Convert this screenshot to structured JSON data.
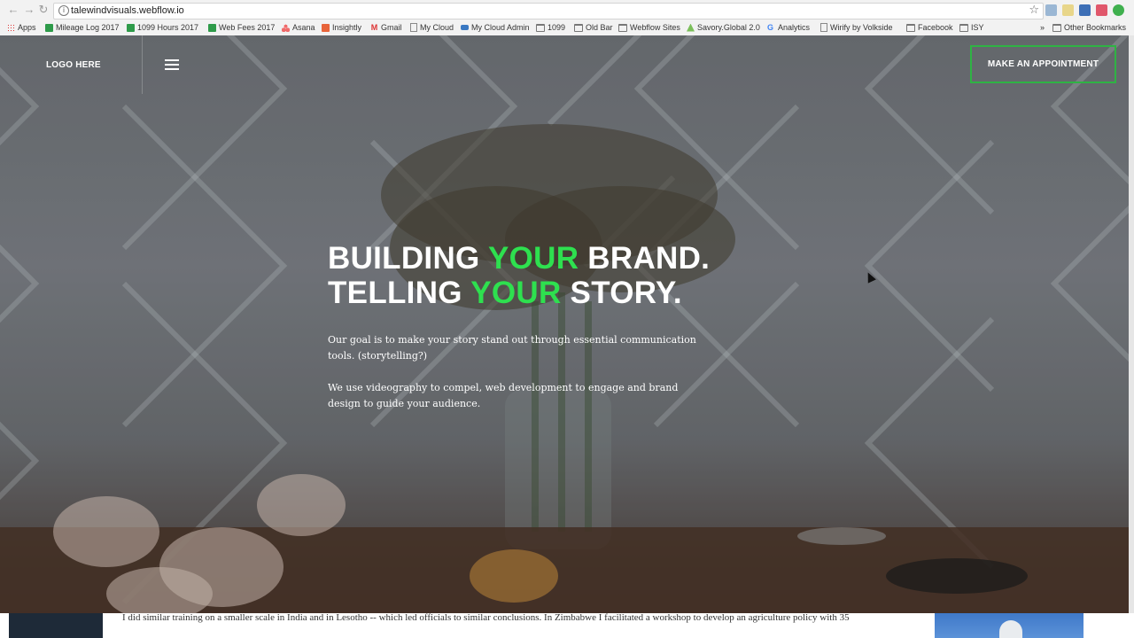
{
  "browser": {
    "url": "talewindvisuals.webflow.io",
    "bookmarks": [
      {
        "label": "Apps",
        "icon": "apps-grid-icon"
      },
      {
        "label": "Mileage Log 2017",
        "icon": "sheets-icon"
      },
      {
        "label": "1099 Hours 2017",
        "icon": "sheets-icon"
      },
      {
        "label": "Web Fees 2017",
        "icon": "sheets-icon"
      },
      {
        "label": "Asana",
        "icon": "asana-icon"
      },
      {
        "label": "Insightly",
        "icon": "insightly-icon"
      },
      {
        "label": "Gmail",
        "icon": "gmail-icon"
      },
      {
        "label": "My Cloud",
        "icon": "page-icon"
      },
      {
        "label": "My Cloud Admin",
        "icon": "cloud-icon"
      },
      {
        "label": "1099",
        "icon": "folder-icon"
      },
      {
        "label": "Old Bar",
        "icon": "folder-icon"
      },
      {
        "label": "Webflow Sites",
        "icon": "folder-icon"
      },
      {
        "label": "Savory.Global 2.0",
        "icon": "savory-icon"
      },
      {
        "label": "Analytics",
        "icon": "google-icon"
      },
      {
        "label": "Wirify by Volkside",
        "icon": "page-icon"
      },
      {
        "label": "Facebook",
        "icon": "folder-icon"
      },
      {
        "label": "ISY",
        "icon": "folder-icon"
      }
    ],
    "overflow": "»",
    "other_bookmarks": "Other Bookmarks"
  },
  "site": {
    "logo": "LOGO HERE",
    "cta": "MAKE AN APPOINTMENT",
    "headline": {
      "line1_a": "BUILDING ",
      "line1_hl": "YOUR",
      "line1_b": " BRAND.",
      "line2_a": "TELLING ",
      "line2_hl": "YOUR",
      "line2_b": " STORY."
    },
    "paragraph1": "Our goal is to make your story stand out through essential communication tools. (storytelling?)",
    "paragraph2": "We use videography to compel, web development to engage and brand design to guide your audience."
  },
  "below_page": {
    "text": "I did similar training on a smaller scale in India and in Lesotho -- which led officials to similar conclusions. In Zimbabwe I facilitated a workshop to develop an agriculture policy with 35"
  },
  "colors": {
    "accent_green": "#2ee04f",
    "cta_border": "#2fb344"
  }
}
